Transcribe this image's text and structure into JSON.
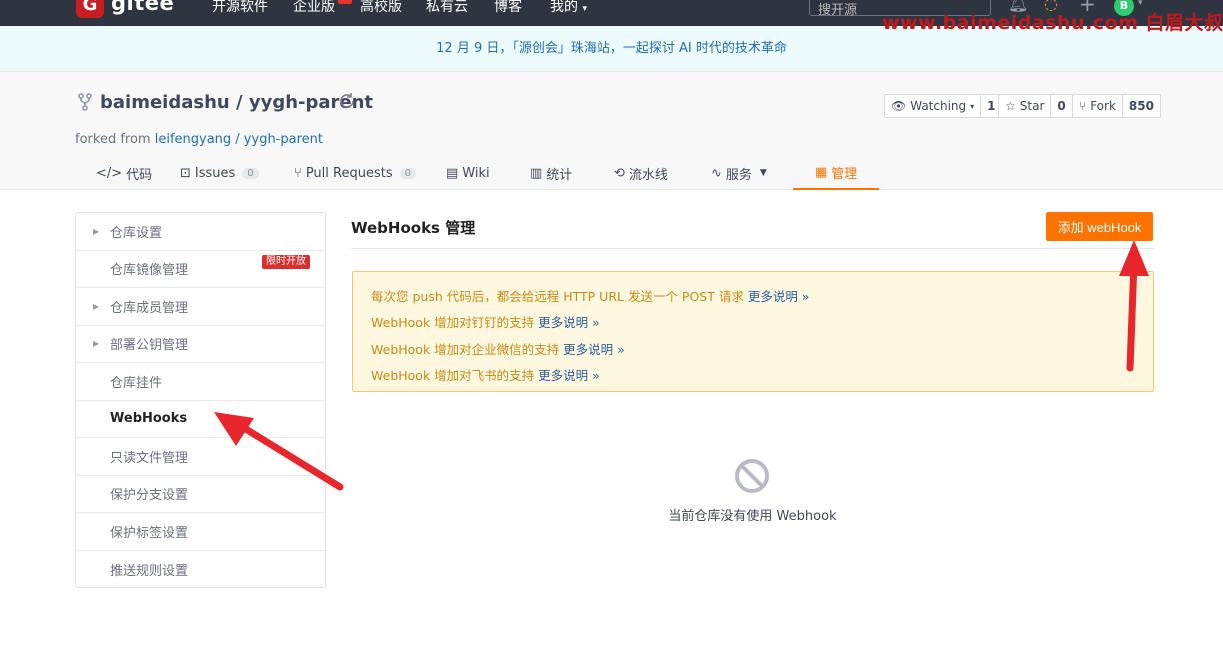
{
  "topnav": {
    "brand": "gitee",
    "logo_letter": "G",
    "items": [
      "开源软件",
      "企业版",
      "高校版",
      "私有云",
      "博客",
      "我的"
    ],
    "search_placeholder": "搜开源",
    "avatar_letter": "B"
  },
  "watermark": "www.baimeidashu.com 白眉大叔",
  "banner": "12 月 9 日，「源创会」珠海站，一起探讨 AI 时代的技术革命",
  "repo": {
    "owner": "baimeidashu",
    "separator": "/",
    "name": "yygh-parent",
    "forked_prefix": "forked from",
    "forked_from": "leifengyang / yygh-parent",
    "watching_label": "Watching",
    "watching_count": "1",
    "star_label": "Star",
    "star_count": "0",
    "fork_label": "Fork",
    "fork_count": "850"
  },
  "tabs": [
    {
      "label": "代码"
    },
    {
      "label": "Issues",
      "badge": "0"
    },
    {
      "label": "Pull Requests",
      "badge": "0"
    },
    {
      "label": "Wiki"
    },
    {
      "label": "统计"
    },
    {
      "label": "流水线"
    },
    {
      "label": "服务"
    },
    {
      "label": "管理"
    }
  ],
  "sidebar": {
    "items": [
      {
        "label": "仓库设置"
      },
      {
        "label": "仓库镜像管理",
        "badge": "限时开放"
      },
      {
        "label": "仓库成员管理"
      },
      {
        "label": "部署公钥管理"
      },
      {
        "label": "仓库挂件"
      },
      {
        "label": "WebHooks"
      },
      {
        "label": "只读文件管理"
      },
      {
        "label": "保护分支设置"
      },
      {
        "label": "保护标签设置"
      },
      {
        "label": "推送规则设置"
      }
    ]
  },
  "main": {
    "title": "WebHooks 管理",
    "add_button": "添加 webHook",
    "notice": [
      {
        "text": "每次您 push 代码后，都会给远程 HTTP URL 发送一个 POST 请求",
        "link": "更多说明 »"
      },
      {
        "text": "WebHook 增加对钉钉的支持",
        "link": "更多说明 »"
      },
      {
        "text": "WebHook 增加对企业微信的支持",
        "link": "更多说明 »"
      },
      {
        "text": "WebHook 增加对飞书的支持",
        "link": "更多说明 »"
      }
    ],
    "empty_text": "当前仓库没有使用 Webhook"
  },
  "colors": {
    "accent": "#fe7300",
    "nav_bg": "#2e3440",
    "arrow": "#e8262b"
  }
}
